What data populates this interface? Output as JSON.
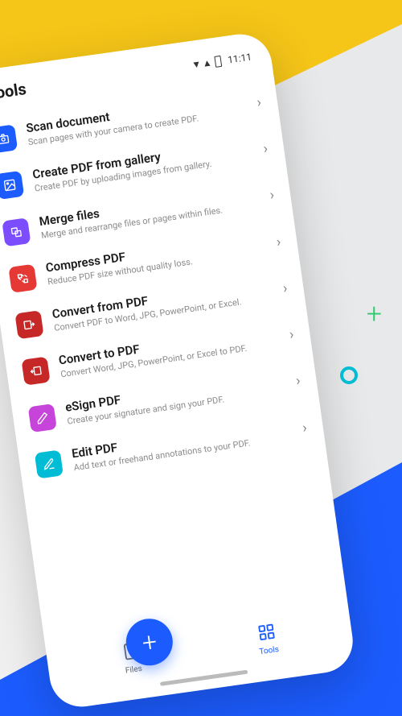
{
  "status": {
    "time": "11:11"
  },
  "header": {
    "title": "Tools"
  },
  "tools": [
    {
      "icon": "camera-icon",
      "color": "ic-blue",
      "title": "Scan document",
      "desc": "Scan pages with your camera to create PDF."
    },
    {
      "icon": "gallery-icon",
      "color": "ic-blue",
      "title": "Create PDF from gallery",
      "desc": "Create PDF by uploading images from gallery."
    },
    {
      "icon": "merge-icon",
      "color": "ic-purple",
      "title": "Merge files",
      "desc": "Merge and rearrange files or pages within files."
    },
    {
      "icon": "compress-icon",
      "color": "ic-red",
      "title": "Compress PDF",
      "desc": "Reduce PDF size without quality loss."
    },
    {
      "icon": "convert-from-icon",
      "color": "ic-darkred",
      "title": "Convert from PDF",
      "desc": "Convert PDF to Word, JPG, PowerPoint, or Excel."
    },
    {
      "icon": "convert-to-icon",
      "color": "ic-darkred",
      "title": "Convert to PDF",
      "desc": "Convert Word, JPG, PowerPoint, or Excel to PDF."
    },
    {
      "icon": "esign-icon",
      "color": "ic-pink",
      "title": "eSign PDF",
      "desc": "Create your signature and sign your PDF."
    },
    {
      "icon": "edit-icon",
      "color": "ic-teal",
      "title": "Edit PDF",
      "desc": "Add text or freehand annotations to your PDF."
    }
  ],
  "nav": {
    "files": "Files",
    "tools": "Tools"
  }
}
